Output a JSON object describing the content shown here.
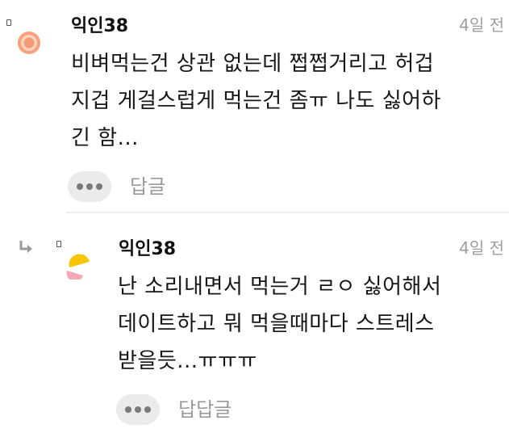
{
  "comments": [
    {
      "nickname": "익인38",
      "time": "4일 전",
      "body": "비벼먹는건 상관 없는데 쩝쩝거리고 허겁\n지겁 게걸스럽게 먹는건 좀ㅠ 나도 싫어하\n긴 함...",
      "reply_label": "답글",
      "avatar_icon": "orange-circle-avatar-icon"
    },
    {
      "nickname": "익인38",
      "time": "4일 전",
      "body": "난 소리내면서 먹는거 ㄹㅇ 싫어해서\n데이트하고 뭐 먹을때마다 스트레스\n받을듯...ㅠㅠㅠ",
      "reply_label": "답답글",
      "avatar_icon": "yellow-pink-avatar-icon"
    }
  ],
  "colors": {
    "avatar_orange": "#f7a07a",
    "avatar_orange_inner": "#ffffff",
    "avatar_yellow": "#f7c600",
    "avatar_pink": "#f3aab6",
    "meta_gray": "#9e9e9e"
  }
}
